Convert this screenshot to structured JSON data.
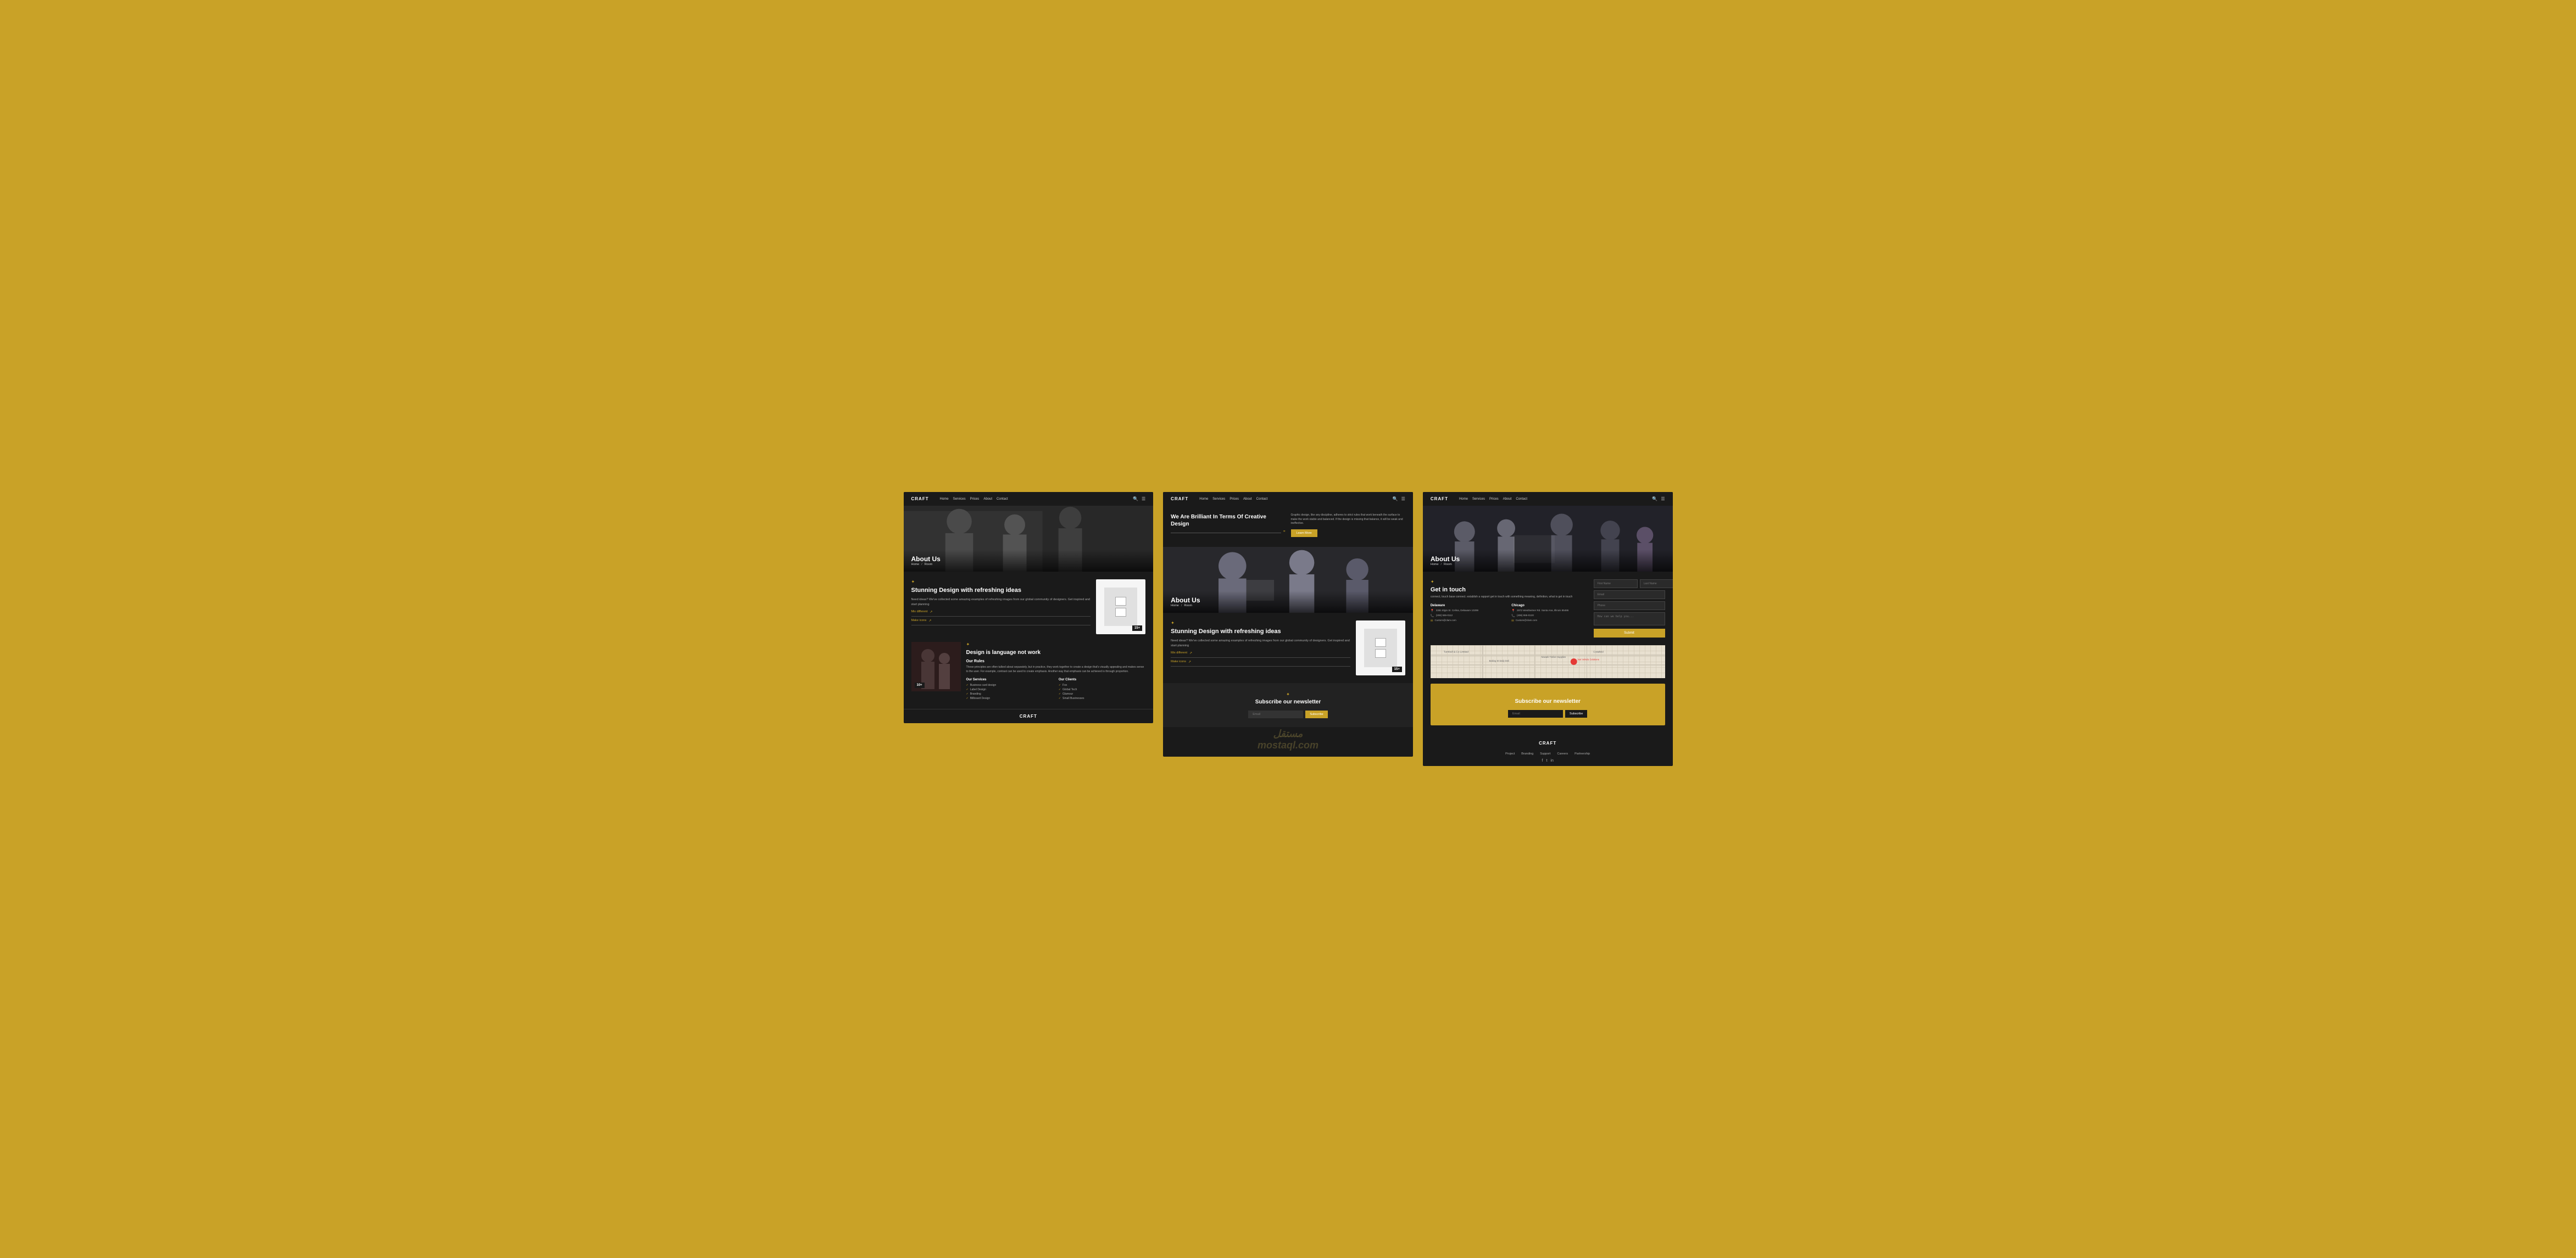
{
  "brand": "CRAFT",
  "nav": {
    "links": [
      "Home",
      "Services",
      "Prices",
      "About",
      "Contact"
    ]
  },
  "screen1": {
    "hero": {
      "title": "About Us",
      "breadcrumb": [
        "Home",
        "/",
        "Room"
      ]
    },
    "design": {
      "star": "✦",
      "heading": "Stunning Design with refreshing ideas",
      "text": "Need ideas? We've collected some amazing examples of refreshing images from our global community of designers. Get inspired and start planning",
      "link1": "Mix different",
      "link2": "Make icons",
      "counter": "15+"
    },
    "language": {
      "star": "✦",
      "heading": "Design is language not work",
      "counter": "10+",
      "rules_title": "Our Rules",
      "rules_text": "These principles are often talked about separately, but in practice, they work together to create a design that's visually appealing and makes sense to the user. For example, contrast can be used to create emphasis. Another way that emphasis can be achieved is through proportion.",
      "services": {
        "title": "Our Services",
        "items": [
          "Business card design",
          "Label Design",
          "Branding",
          "Billboard Design"
        ]
      },
      "clients": {
        "title": "Our Clients",
        "items": [
          "Fox",
          "Global Tech",
          "Glamour",
          "Small Businesses"
        ]
      }
    },
    "footer": "CRAFT"
  },
  "screen2": {
    "hero": {
      "title": "About Us",
      "breadcrumb": [
        "Home",
        "/",
        "Room"
      ]
    },
    "brilliant": {
      "heading": "We Are Brilliant In Terms Of Creative Design",
      "text": "Graphic design, like any discipline, adheres to strict rules that work beneath the surface to make the work stable and balanced. If the design is missing that balance, it will be weak and ineffective.",
      "btn": "Learn More"
    },
    "design": {
      "star": "✦",
      "heading": "Stunning Design with refreshing ideas",
      "text": "Need ideas? We've collected some amazing examples of refreshing images from our global community of designers. Get inspired and start planning",
      "link1": "Mix different",
      "link2": "Make icons",
      "counter": "15+"
    },
    "subscribe": {
      "star": "✦",
      "heading": "Subscribe our newsletter",
      "email_placeholder": "Email",
      "btn": "Subscribe"
    },
    "watermark": "مستقل\nmostaql.com"
  },
  "screen3": {
    "hero": {
      "title": "About Us",
      "breadcrumb": [
        "Home",
        "/",
        "Room"
      ]
    },
    "contact": {
      "star": "✦",
      "heading": "Get in touch",
      "subtext": "connect, touch base connect. establish a rapport get in touch with something meaning, definition, what is get in touch",
      "locations": [
        {
          "city": "Delaware",
          "address": "3381 Elgin St. Celina, Delaware 10299",
          "phone": "(208) 555-0112",
          "email": "Custom@clam.com"
        },
        {
          "city": "Chicago",
          "address": "2972 Westheimer Rd. Santa Ana, Illinois 85486",
          "phone": "(406) 555-0120",
          "email": "Custom@clam.com"
        }
      ],
      "form": {
        "first_name": "First Name",
        "last_name": "Last Name",
        "email": "Email",
        "phone": "Phone",
        "message": "How can we help you...",
        "submit": "Submit"
      }
    },
    "subscribe": {
      "star": "✦",
      "heading": "Subscribe our newsletter",
      "email_placeholder": "Email",
      "btn": "Subscribe"
    },
    "footer_nav": [
      "Project",
      "Branding",
      "Support",
      "Careers",
      "Partnership"
    ],
    "footer": "CRAFT"
  }
}
